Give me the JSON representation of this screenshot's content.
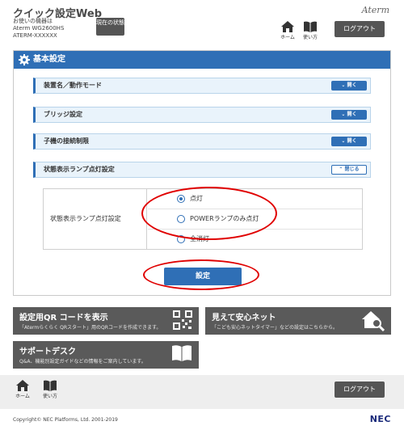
{
  "header": {
    "app_title": "クイック設定Web",
    "device_label": "お使いの機器は",
    "device_model": "Aterm WG2600HS",
    "device_id": "ATERM-XXXXXX",
    "status_button": "現在の状態",
    "brand": "Aterm",
    "home_label": "ホーム",
    "help_label": "使い方",
    "logout_label": "ログアウト"
  },
  "panel": {
    "title": "基本設定",
    "sections": [
      {
        "label": "装置名／動作モード",
        "button": "開く"
      },
      {
        "label": "ブリッジ設定",
        "button": "開く"
      },
      {
        "label": "子機の接続制限",
        "button": "開く"
      },
      {
        "label": "状態表示ランプ点灯設定",
        "button": "閉じる"
      }
    ],
    "setting_label": "状態表示ランプ点灯設定",
    "options": [
      {
        "label": "点灯",
        "checked": true
      },
      {
        "label": "POWERランプのみ点灯",
        "checked": false
      },
      {
        "label": "全消灯",
        "checked": false
      }
    ],
    "submit_label": "設定"
  },
  "tiles": [
    {
      "title": "設定用QR コードを表示",
      "desc": "「Atermらくらく QRスタート」用のQRコードを作成できます。",
      "icon": "qr-code-icon"
    },
    {
      "title": "見えて安心ネット",
      "desc": "「こども安心ネットタイマー」などの設定はこちらから。",
      "icon": "house-search-icon"
    },
    {
      "title": "サポートデスク",
      "desc": "Q&A、機能別設定ガイドなどの情報をご案内しています。",
      "icon": "book-icon"
    }
  ],
  "footer": {
    "home_label": "ホーム",
    "help_label": "使い方",
    "logout_label": "ログアウト",
    "copyright": "Copyright© NEC Platforms, Ltd. 2001-2019",
    "brand": "NEC"
  },
  "colors": {
    "accent": "#2f6fb6",
    "dark_button": "#555555",
    "highlight": "#e00000"
  }
}
